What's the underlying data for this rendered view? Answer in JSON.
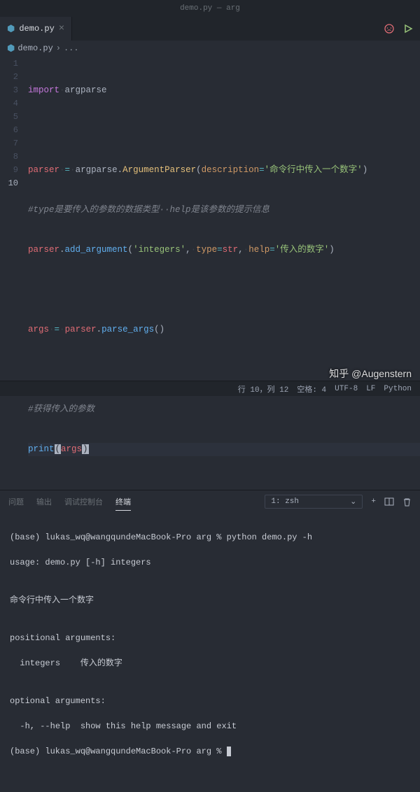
{
  "window": {
    "title": "demo.py — arg"
  },
  "tab": {
    "icon": "⬢",
    "name": "demo.py"
  },
  "breadcrumb": {
    "icon": "⬢",
    "file": "demo.py",
    "sep": "›",
    "more": "..."
  },
  "code": {
    "lines": [
      {
        "n": "1"
      },
      {
        "n": "2"
      },
      {
        "n": "3"
      },
      {
        "n": "4"
      },
      {
        "n": "5"
      },
      {
        "n": "6"
      },
      {
        "n": "7"
      },
      {
        "n": "8"
      },
      {
        "n": "9"
      },
      {
        "n": "10"
      }
    ],
    "l1": {
      "import": "import",
      "mod": "argparse",
      "ws": "·"
    },
    "l3": {
      "var": "parser",
      "ws": "·",
      "op": "=",
      "mod": "argparse",
      "dot": ".",
      "cls": "ArgumentParser",
      "lp": "(",
      "param": "description",
      "eq": "=",
      "str": "'命令行中传入一个数字'",
      "rp": ")"
    },
    "l4": {
      "cmt": "#type是要传入的参数的数据类型··help是该参数的提示信息"
    },
    "l5": {
      "var": "parser",
      "dot": ".",
      "fn": "add_argument",
      "lp": "(",
      "s1": "'integers'",
      "c1": ",",
      "ws": "·",
      "p1": "type",
      "eq": "=",
      "v1": "str",
      "c2": ",",
      "p2": "help",
      "s2": "'传入的数字'",
      "rp": ")"
    },
    "l7": {
      "var": "args",
      "ws": "·",
      "op": "=",
      "var2": "parser",
      "dot": ".",
      "fn": "parse_args",
      "lp": "(",
      "rp": ")"
    },
    "l9": {
      "cmt": "#获得传入的参数"
    },
    "l10": {
      "fn": "print",
      "lp": "(",
      "var": "args",
      "rp": ")"
    }
  },
  "panel": {
    "tabs": {
      "problems": "问题",
      "output": "输出",
      "debug": "调试控制台",
      "terminal": "终端"
    },
    "select": {
      "label": "1: zsh"
    }
  },
  "terminal": {
    "l1": "(base) lukas_wq@wangqundeMacBook-Pro arg % python demo.py -h",
    "l2": "usage: demo.py [-h] integers",
    "l3": "",
    "l4": "命令行中传入一个数字",
    "l5": "",
    "l6": "positional arguments:",
    "l7": "  integers    传入的数字",
    "l8": "",
    "l9": "optional arguments:",
    "l10": "  -h, --help  show this help message and exit",
    "l11": "(base) lukas_wq@wangqundeMacBook-Pro arg % "
  },
  "status": {
    "pos": "行 10，列 12",
    "spaces": "空格: 4",
    "encoding": "UTF-8",
    "eol": "LF",
    "lang": "Python"
  },
  "watermark": "知乎 @Augenstern"
}
